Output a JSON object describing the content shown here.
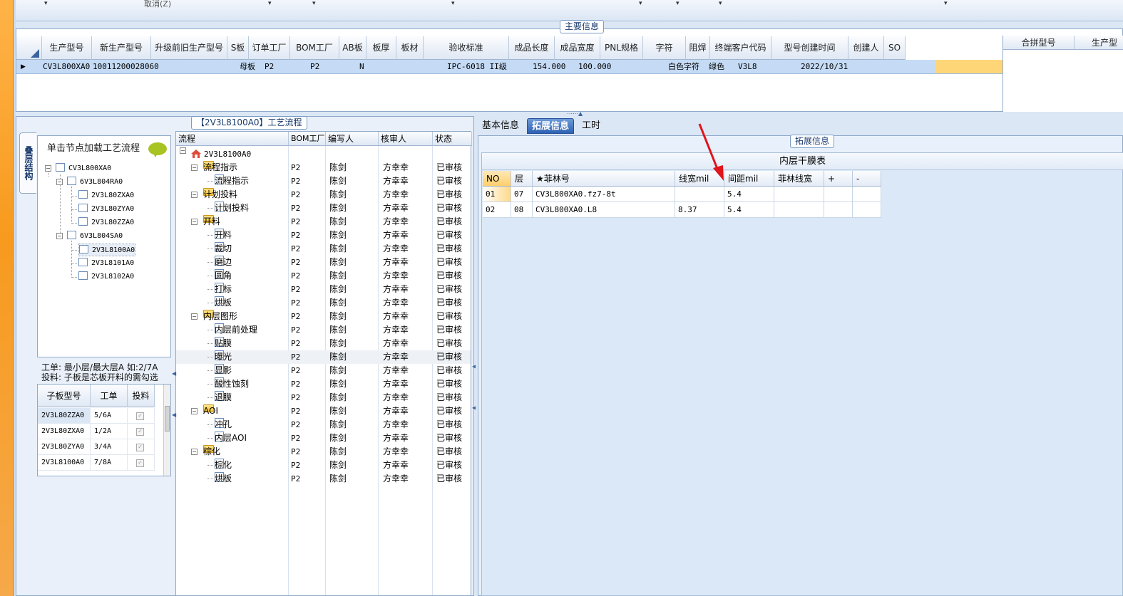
{
  "toolbar": {
    "cancel_label": "取消(Z)"
  },
  "main_info": {
    "caption": "主要信息",
    "columns": [
      "生产型号",
      "新生产型号",
      "升级前旧生产型号",
      "S板",
      "订单工厂",
      "BOM工厂",
      "AB板",
      "板厚",
      "板材",
      "验收标准",
      "成品长度",
      "成品宽度",
      "PNL规格",
      "字符",
      "阻焊",
      "终端客户代码",
      "型号创建时间",
      "创建人",
      "SO"
    ],
    "row": {
      "model": "CV3L800XA0",
      "new_model": "10011200028060",
      "old_model": "",
      "s_board": "母板",
      "order_factory": "P2",
      "bom_factory": "P2",
      "ab_board": "N",
      "thickness": "",
      "material": "",
      "standard": "IPC-6018 II级",
      "length": "154.000",
      "width": "100.000",
      "pnl": "",
      "char": "白色字符",
      "solder_mask": "绿色",
      "customer_code": "V3L8",
      "created": "2022/10/31",
      "creator": "",
      "so": ""
    },
    "merge_columns": [
      "合拼型号",
      "生产型"
    ]
  },
  "structure": {
    "vtab_label": "叠层结构",
    "load_tip": "单击节点加载工艺流程",
    "tree": [
      "CV3L800XA0",
      "6V3L804RA0",
      "2V3L80ZXA0",
      "2V3L80ZYA0",
      "2V3L80ZZA0",
      "6V3L804SA0",
      "2V3L8100A0",
      "2V3L8101A0",
      "2V3L8102A0"
    ],
    "note_line1": "工单: 最小层/最大层A 如:2/7A",
    "note_line2": "投料: 子板是芯板开料的需勾选",
    "child_columns": [
      "子板型号",
      "工单",
      "投料"
    ],
    "child_rows": [
      {
        "model": "2V3L80ZZA0",
        "order": "5/6A"
      },
      {
        "model": "2V3L80ZXA0",
        "order": "1/2A"
      },
      {
        "model": "2V3L80ZYA0",
        "order": "3/4A"
      },
      {
        "model": "2V3L8100A0",
        "order": "7/8A"
      }
    ]
  },
  "process": {
    "caption": "【2V3L8100A0】工艺流程",
    "columns": [
      "流程",
      "BOM工厂",
      "编写人",
      "核审人",
      "状态"
    ],
    "root": "2V3L8100A0",
    "rows": [
      {
        "name": "流程指示",
        "factory": "P2",
        "writer": "陈剑",
        "reviewer": "方幸幸",
        "status": "已审核"
      },
      {
        "name": "流程指示",
        "factory": "P2",
        "writer": "陈剑",
        "reviewer": "方幸幸",
        "status": "已审核"
      },
      {
        "name": "计划投料",
        "factory": "P2",
        "writer": "陈剑",
        "reviewer": "方幸幸",
        "status": "已审核"
      },
      {
        "name": "计划投料",
        "factory": "P2",
        "writer": "陈剑",
        "reviewer": "方幸幸",
        "status": "已审核"
      },
      {
        "name": "开料",
        "factory": "P2",
        "writer": "陈剑",
        "reviewer": "方幸幸",
        "status": "已审核"
      },
      {
        "name": "开料",
        "factory": "P2",
        "writer": "陈剑",
        "reviewer": "方幸幸",
        "status": "已审核"
      },
      {
        "name": "裁切",
        "factory": "P2",
        "writer": "陈剑",
        "reviewer": "方幸幸",
        "status": "已审核"
      },
      {
        "name": "磨边",
        "factory": "P2",
        "writer": "陈剑",
        "reviewer": "方幸幸",
        "status": "已审核"
      },
      {
        "name": "圆角",
        "factory": "P2",
        "writer": "陈剑",
        "reviewer": "方幸幸",
        "status": "已审核"
      },
      {
        "name": "打标",
        "factory": "P2",
        "writer": "陈剑",
        "reviewer": "方幸幸",
        "status": "已审核"
      },
      {
        "name": "烘板",
        "factory": "P2",
        "writer": "陈剑",
        "reviewer": "方幸幸",
        "status": "已审核"
      },
      {
        "name": "内层图形",
        "factory": "P2",
        "writer": "陈剑",
        "reviewer": "方幸幸",
        "status": "已审核"
      },
      {
        "name": "内层前处理",
        "factory": "P2",
        "writer": "陈剑",
        "reviewer": "方幸幸",
        "status": "已审核"
      },
      {
        "name": "贴膜",
        "factory": "P2",
        "writer": "陈剑",
        "reviewer": "方幸幸",
        "status": "已审核"
      },
      {
        "name": "曝光",
        "factory": "P2",
        "writer": "陈剑",
        "reviewer": "方幸幸",
        "status": "已审核"
      },
      {
        "name": "显影",
        "factory": "P2",
        "writer": "陈剑",
        "reviewer": "方幸幸",
        "status": "已审核"
      },
      {
        "name": "酸性蚀刻",
        "factory": "P2",
        "writer": "陈剑",
        "reviewer": "方幸幸",
        "status": "已审核"
      },
      {
        "name": "退膜",
        "factory": "P2",
        "writer": "陈剑",
        "reviewer": "方幸幸",
        "status": "已审核"
      },
      {
        "name": "AOI",
        "factory": "P2",
        "writer": "陈剑",
        "reviewer": "方幸幸",
        "status": "已审核"
      },
      {
        "name": "冲孔",
        "factory": "P2",
        "writer": "陈剑",
        "reviewer": "方幸幸",
        "status": "已审核"
      },
      {
        "name": "内层AOI",
        "factory": "P2",
        "writer": "陈剑",
        "reviewer": "方幸幸",
        "status": "已审核"
      },
      {
        "name": "棕化",
        "factory": "P2",
        "writer": "陈剑",
        "reviewer": "方幸幸",
        "status": "已审核"
      },
      {
        "name": "棕化",
        "factory": "P2",
        "writer": "陈剑",
        "reviewer": "方幸幸",
        "status": "已审核"
      },
      {
        "name": "烘板",
        "factory": "P2",
        "writer": "陈剑",
        "reviewer": "方幸幸",
        "status": "已审核"
      }
    ]
  },
  "tabs": {
    "basic": "基本信息",
    "extended": "拓展信息",
    "hours": "工时"
  },
  "extended": {
    "caption": "拓展信息",
    "table_title": "内层干膜表",
    "columns": [
      "NO",
      "层",
      "★菲林号",
      "线宽mil",
      "间距mil",
      "菲林线宽",
      "+",
      "-"
    ],
    "rows": [
      {
        "no": "01",
        "layer": "07",
        "film": "CV3L800XA0.fz7-8t",
        "width": "",
        "spacing": "5.4",
        "film_width": ""
      },
      {
        "no": "02",
        "layer": "08",
        "film": "CV3L800XA0.L8",
        "width": "8.37",
        "spacing": "5.4",
        "film_width": ""
      }
    ]
  },
  "colors": {
    "accent_orange": "#f79a1e",
    "selected_row": "#c5dbf5",
    "annotation_red": "#e0141b"
  }
}
